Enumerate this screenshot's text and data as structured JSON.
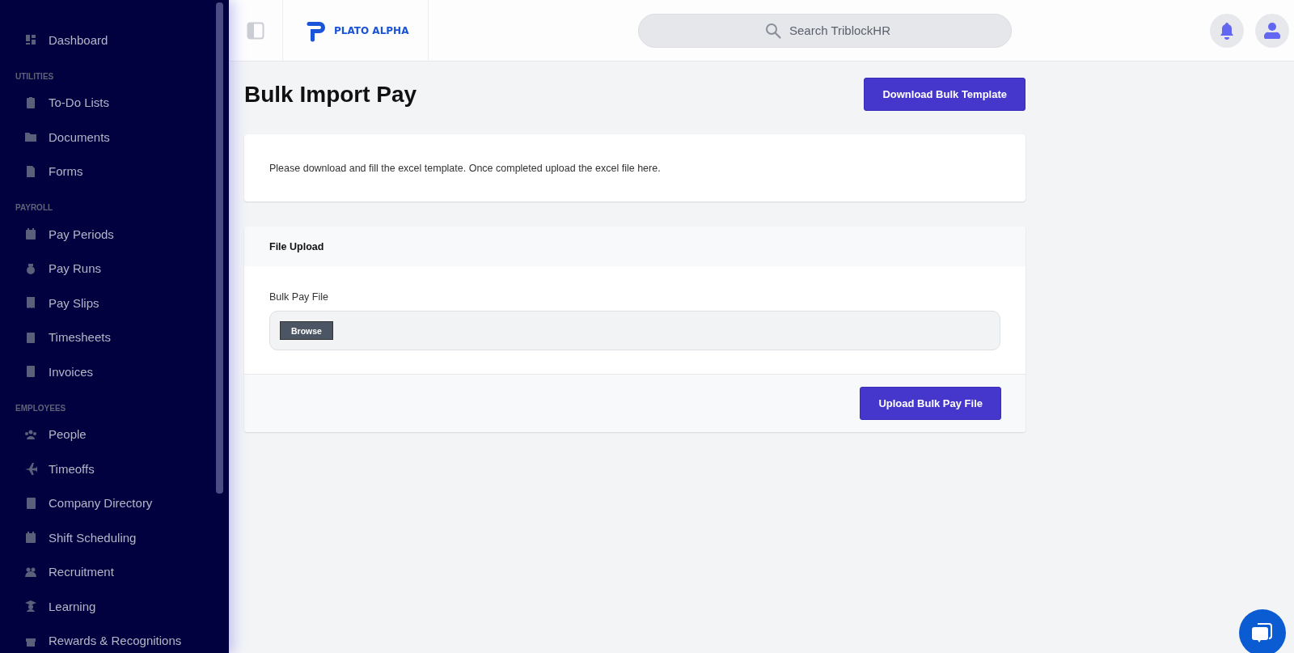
{
  "sidebar": {
    "sections": [
      {
        "items": [
          {
            "label": "Dashboard"
          }
        ]
      },
      {
        "heading": "UTILITIES",
        "items": [
          {
            "label": "To-Do Lists"
          },
          {
            "label": "Documents"
          },
          {
            "label": "Forms"
          }
        ]
      },
      {
        "heading": "PAYROLL",
        "items": [
          {
            "label": "Pay Periods"
          },
          {
            "label": "Pay Runs"
          },
          {
            "label": "Pay Slips"
          },
          {
            "label": "Timesheets"
          },
          {
            "label": "Invoices"
          }
        ]
      },
      {
        "heading": "EMPLOYEES",
        "items": [
          {
            "label": "People"
          },
          {
            "label": "Timeoffs"
          },
          {
            "label": "Company Directory"
          },
          {
            "label": "Shift Scheduling"
          },
          {
            "label": "Recruitment"
          },
          {
            "label": "Learning"
          },
          {
            "label": "Rewards & Recognitions"
          }
        ]
      }
    ]
  },
  "header": {
    "logo": "PLATO ALPHA",
    "search": {
      "placeholder": "Search TriblockHR"
    }
  },
  "page": {
    "title": "Bulk Import Pay",
    "download_button": "Download Bulk Template",
    "info": "Please download and fill the excel template. Once completed upload the excel file here.",
    "upload_card": {
      "title": "File Upload",
      "field_label": "Bulk Pay File",
      "browse_button": "Browse",
      "submit_button": "Upload Bulk Pay File"
    }
  }
}
